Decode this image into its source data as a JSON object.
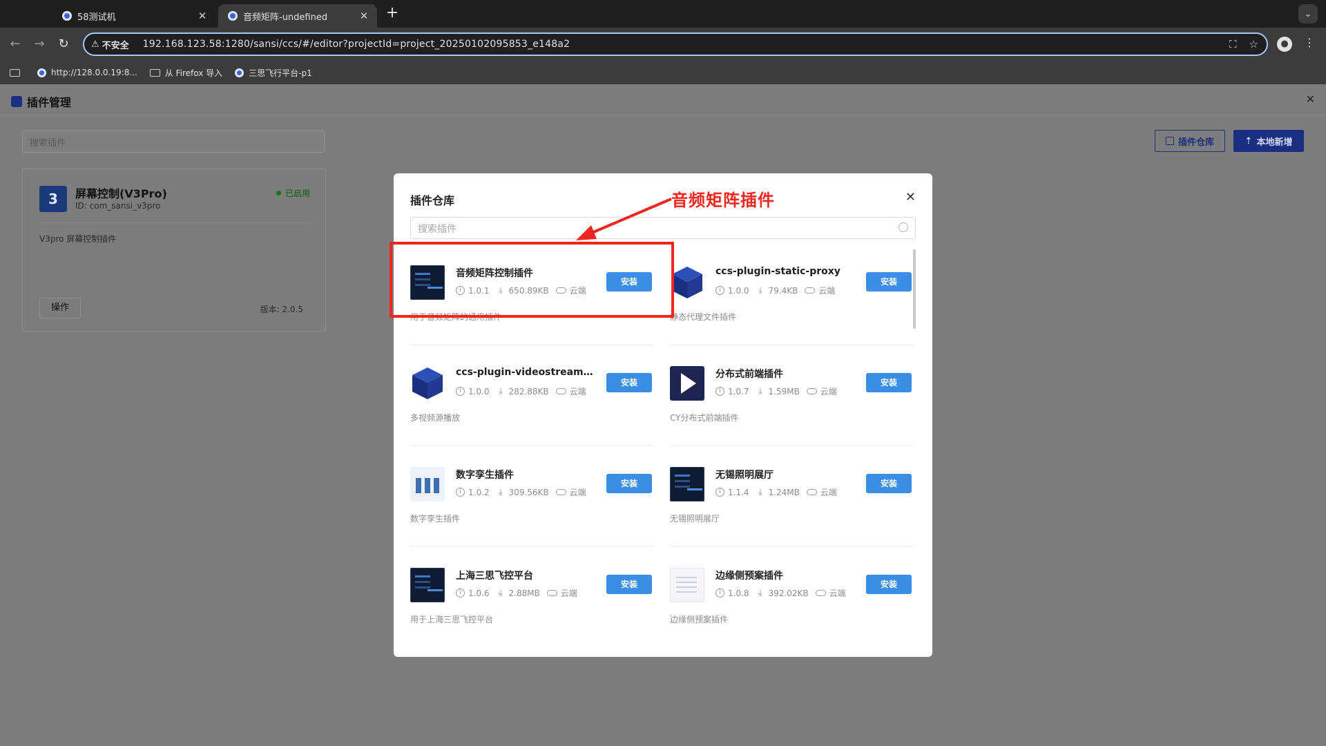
{
  "browser": {
    "tabs": [
      {
        "title": "58测试机",
        "active": false
      },
      {
        "title": "音频矩阵-undefined",
        "active": true
      }
    ],
    "security_label": "不安全",
    "url": "192.168.123.58:1280/sansi/ccs/#/editor?projectId=project_20250102095853_e148a2",
    "bookmarks": [
      {
        "label": "http://128.0.0.19:8...",
        "icon": "globe-icon"
      },
      {
        "label": "从 Firefox 导入",
        "icon": "folder-icon"
      },
      {
        "label": "三思飞行平台-p1",
        "icon": "globe-icon"
      }
    ]
  },
  "app": {
    "title": "插件管理",
    "search_placeholder": "搜索插件",
    "repo_button": "插件仓库",
    "local_button": "本地新增",
    "installed_card": {
      "logo_text": "3",
      "name": "屏幕控制(V3Pro)",
      "id": "ID: com_sansi_v3pro",
      "status": "已启用",
      "description": "V3pro 屏幕控制插件",
      "action_label": "操作",
      "version": "版本: 2.0.5"
    }
  },
  "modal": {
    "title": "插件仓库",
    "search_placeholder": "搜索插件",
    "install_label": "安装",
    "items": [
      {
        "name": "音频矩阵控制插件",
        "version": "1.0.1",
        "size": "650.89KB",
        "source": "云端",
        "desc": "用于音频矩阵的通用插件",
        "icon": "dark"
      },
      {
        "name": "ccs-plugin-static-proxy",
        "version": "1.0.0",
        "size": "79.4KB",
        "source": "云端",
        "desc": "静态代理文件插件",
        "icon": "cube"
      },
      {
        "name": "ccs-plugin-videostream-pl...",
        "version": "1.0.0",
        "size": "282.88KB",
        "source": "云端",
        "desc": "多视频源播放",
        "icon": "cube"
      },
      {
        "name": "分布式前端插件",
        "version": "1.0.7",
        "size": "1.59MB",
        "source": "云端",
        "desc": "CY分布式前端插件",
        "icon": "play"
      },
      {
        "name": "数字孪生插件",
        "version": "1.0.2",
        "size": "309.56KB",
        "source": "云端",
        "desc": "数字孪生插件",
        "icon": "twin"
      },
      {
        "name": "无锡照明展厅",
        "version": "1.1.4",
        "size": "1.24MB",
        "source": "云端",
        "desc": "无锡照明展厅",
        "icon": "dark"
      },
      {
        "name": "上海三思飞控平台",
        "version": "1.0.6",
        "size": "2.88MB",
        "source": "云端",
        "desc": "用于上海三思飞控平台",
        "icon": "dark"
      },
      {
        "name": "边缘侧预案插件",
        "version": "1.0.8",
        "size": "392.02KB",
        "source": "云端",
        "desc": "边缘侧预案插件",
        "icon": "doc"
      }
    ]
  },
  "annotation": {
    "text": "音频矩阵插件",
    "color": "#f0251d"
  }
}
